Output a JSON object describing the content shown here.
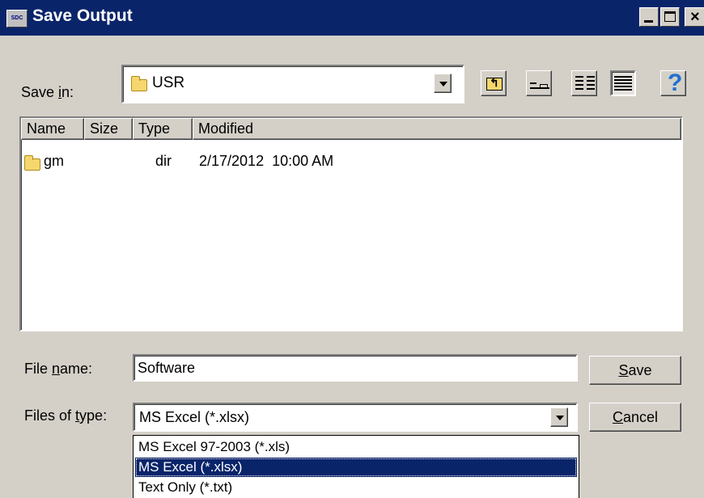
{
  "window": {
    "title": "Save Output",
    "icon_label": "SDC"
  },
  "save_in": {
    "label_pre": "Save ",
    "label_ul": "i",
    "label_post": "n:",
    "value": "USR"
  },
  "file_list": {
    "columns": [
      "Name",
      "Size",
      "Type",
      "Modified"
    ],
    "rows": [
      {
        "name": "gm",
        "size": "",
        "type": "dir",
        "modified": "2/17/2012  10:00 AM"
      }
    ]
  },
  "file_name": {
    "label_pre": "File ",
    "label_ul": "n",
    "label_post": "ame:",
    "value": "Software"
  },
  "file_type": {
    "label_pre": "Files of ",
    "label_ul": "t",
    "label_post": "ype:",
    "value": "MS Excel (*.xlsx)",
    "options": [
      "MS Excel 97-2003 (*.xls)",
      "MS Excel (*.xlsx)",
      "Text Only (*.txt)"
    ]
  },
  "buttons": {
    "save_ul": "S",
    "save_rest": "ave",
    "cancel_ul": "C",
    "cancel_rest": "ancel"
  },
  "toolbar": {
    "help_glyph": "?"
  }
}
